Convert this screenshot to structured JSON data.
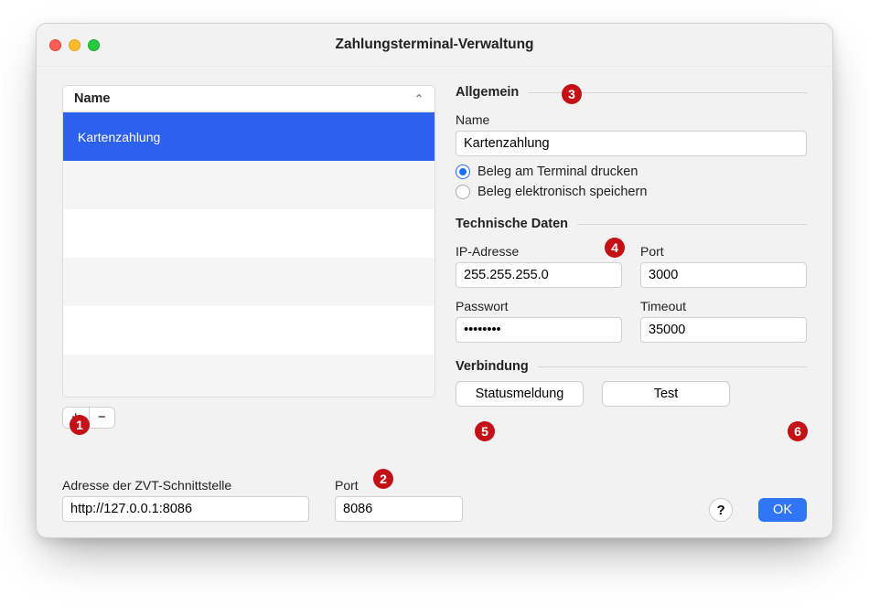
{
  "window": {
    "title": "Zahlungsterminal-Verwaltung"
  },
  "table": {
    "header": "Name",
    "rows": [
      "Kartenzahlung"
    ]
  },
  "buttons": {
    "add_label": "+",
    "remove_label": "−",
    "status_label": "Statusmeldung",
    "test_label": "Test",
    "help_label": "?",
    "ok_label": "OK"
  },
  "sections": {
    "general": "Allgemein",
    "tech": "Technische Daten",
    "conn": "Verbindung"
  },
  "general": {
    "name_label": "Name",
    "name_value": "Kartenzahlung",
    "radio_print": "Beleg am Terminal drucken",
    "radio_store": "Beleg elektronisch speichern"
  },
  "tech": {
    "ip_label": "IP-Adresse",
    "ip_value": "255.255.255.0",
    "port_label": "Port",
    "port_value": "3000",
    "pw_label": "Passwort",
    "pw_value": "••••••••",
    "timeout_label": "Timeout",
    "timeout_value": "35000"
  },
  "zvt": {
    "addr_label": "Adresse der ZVT-Schnittstelle",
    "addr_value": "http://127.0.0.1:8086",
    "port_label": "Port",
    "port_value": "8086"
  },
  "annotations": [
    "1",
    "2",
    "3",
    "4",
    "5",
    "6"
  ]
}
